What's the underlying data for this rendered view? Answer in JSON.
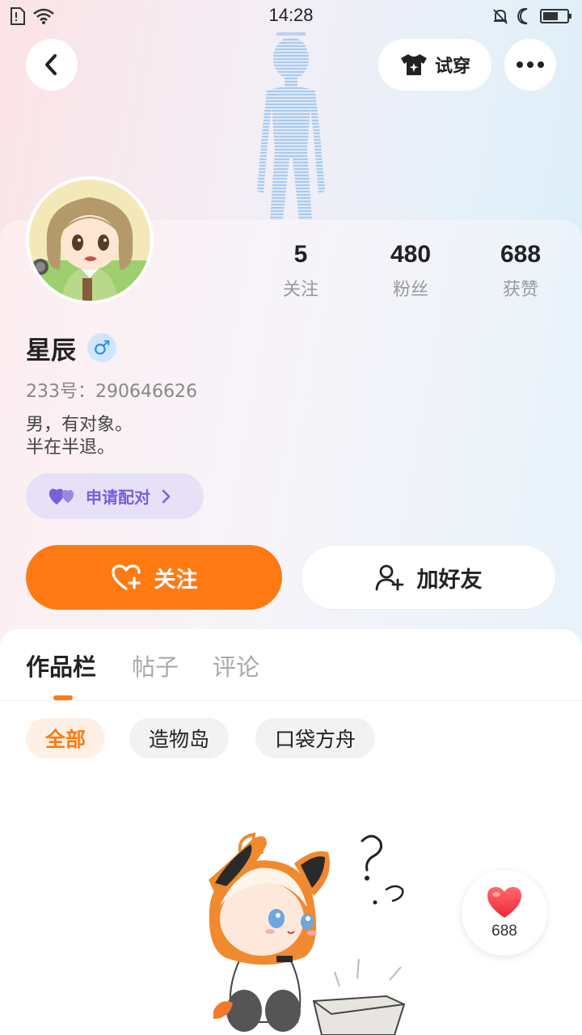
{
  "status_bar": {
    "time": "14:28"
  },
  "header": {
    "tryon_label": "试穿"
  },
  "profile": {
    "username": "星辰",
    "gender_symbol": "♂",
    "uid_text": "233号：290646626",
    "bio": "男，有对象。\n半在半退。",
    "pair_label": "申请配对"
  },
  "stats": [
    {
      "value": "5",
      "label": "关注"
    },
    {
      "value": "480",
      "label": "粉丝"
    },
    {
      "value": "688",
      "label": "获赞"
    }
  ],
  "actions": {
    "follow_label": "关注",
    "add_friend_label": "加好友"
  },
  "tabs": [
    {
      "label": "作品栏",
      "active": true
    },
    {
      "label": "帖子",
      "active": false
    },
    {
      "label": "评论",
      "active": false
    }
  ],
  "chips": [
    {
      "label": "全部",
      "active": true
    },
    {
      "label": "造物岛",
      "active": false
    },
    {
      "label": "口袋方舟",
      "active": false
    }
  ],
  "like_fab": {
    "count": "688"
  },
  "colors": {
    "accent": "#ff7a13",
    "pair_purple": "#7a5fd8",
    "gender_blue": "#2b8be0"
  }
}
